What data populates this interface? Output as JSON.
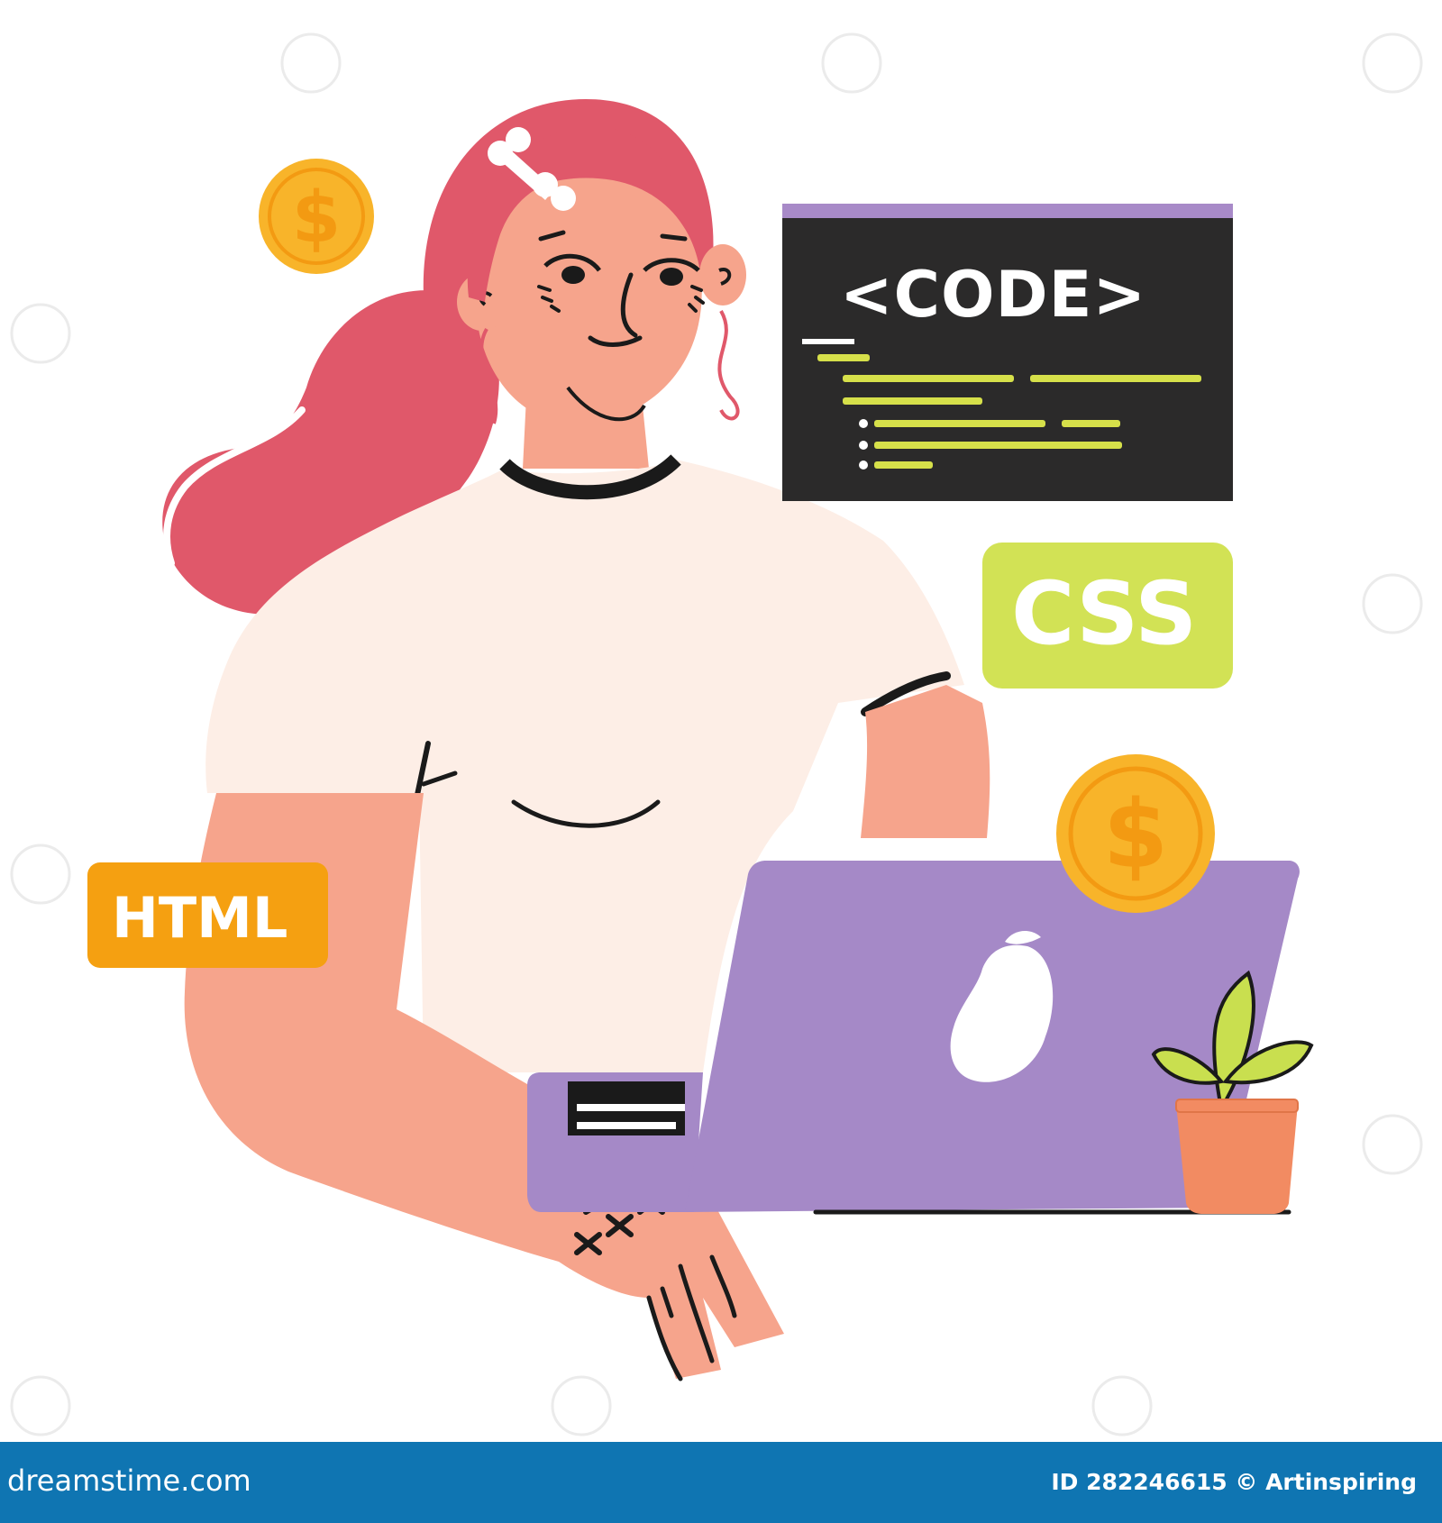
{
  "labels": {
    "code": "<CODE>",
    "css": "CSS",
    "html": "HTML"
  },
  "footer": {
    "brand": "dreamstime.com",
    "id_text": "ID 282246615 © Artinspiring"
  },
  "icons": {
    "coins": [
      "dollar-coin-icon",
      "dollar-coin-icon"
    ],
    "laptop_logo": "pear-logo-icon"
  },
  "colors": {
    "hair": "#e0586a",
    "skin": "#f6a48c",
    "shirt": "#fdeee6",
    "code_window": "#2b2a2a",
    "code_window_bar": "#a88ac8",
    "code_lines": "#d6e04a",
    "css_badge": "#d2e255",
    "html_badge": "#f5a011",
    "laptop": "#a589c7",
    "coin": "#f8b42a",
    "pot": "#f28b62",
    "plant": "#c9df4f",
    "footer": "#0f75b2"
  }
}
